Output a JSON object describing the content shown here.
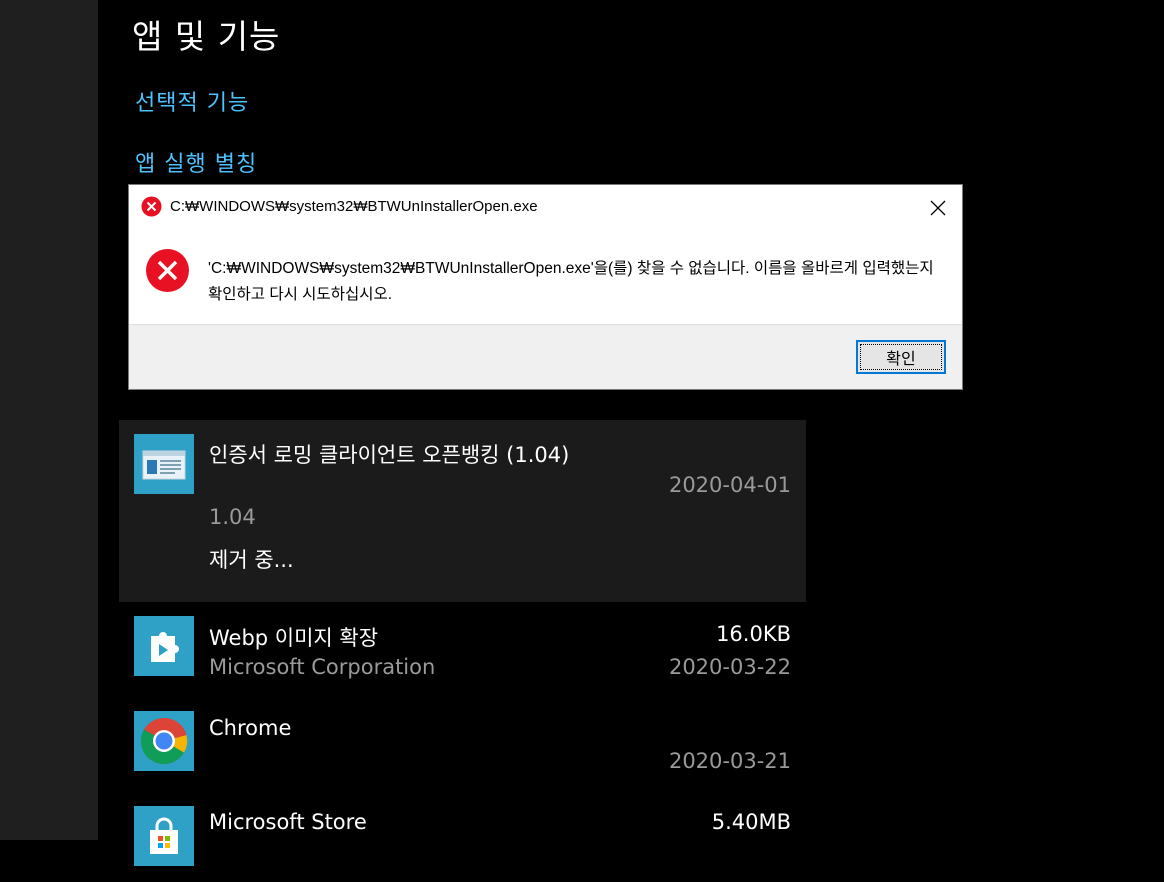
{
  "page": {
    "title": "앱 및 기능",
    "links": [
      "선택적 기능",
      "앱 실행 별칭"
    ]
  },
  "dialog": {
    "title": "C:₩WINDOWS₩system32₩BTWUnInstallerOpen.exe",
    "message": "'C:₩WINDOWS₩system32₩BTWUnInstallerOpen.exe'을(를) 찾을 수 없습니다. 이름을 올바르게 입력했는지 확인하고 다시 시도하십시오.",
    "ok_label": "확인",
    "icon": "error-icon",
    "accent": "#0078d7"
  },
  "apps": [
    {
      "name": "인증서 로밍 클라이언트 오픈뱅킹 (1.04)",
      "publisher": "",
      "size": "",
      "date": "2020-04-01",
      "version": "1.04",
      "status": "제거 중...",
      "icon": "window-app-icon",
      "selected": true
    },
    {
      "name": "Webp 이미지 확장",
      "publisher": "Microsoft Corporation",
      "size": "16.0KB",
      "date": "2020-03-22",
      "icon": "puzzle-play-icon"
    },
    {
      "name": "Chrome",
      "publisher": "",
      "size": "",
      "date": "2020-03-21",
      "icon": "chrome-icon"
    },
    {
      "name": "Microsoft Store",
      "publisher": "",
      "size": "5.40MB",
      "date": "",
      "icon": "store-bag-icon"
    }
  ],
  "colors": {
    "link": "#4cc2ff",
    "tile": "#2fa0c6",
    "selected_bg": "#1b1b1b",
    "error_red": "#e81123"
  }
}
